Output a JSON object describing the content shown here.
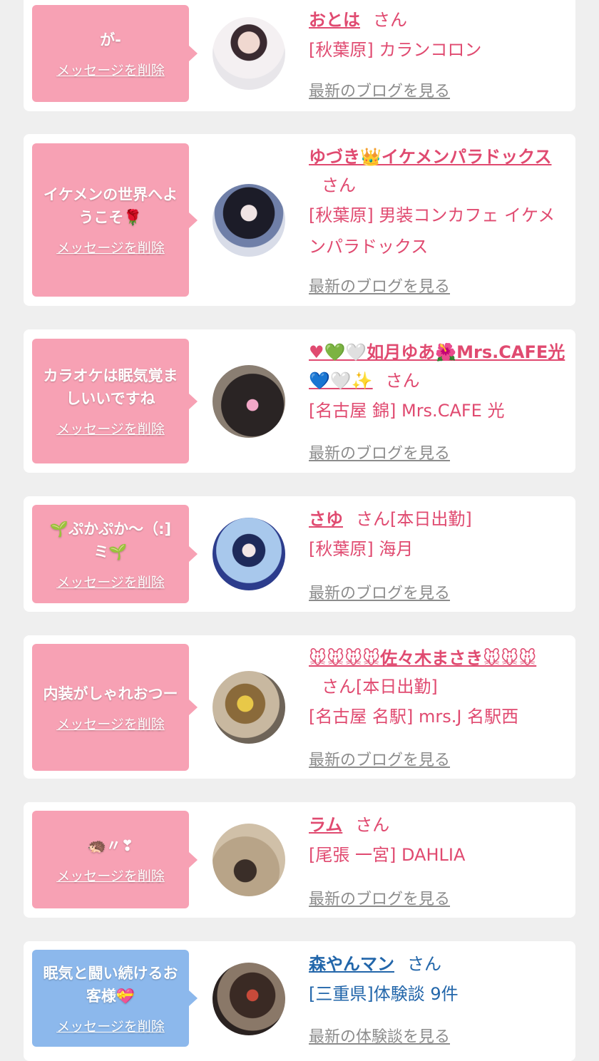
{
  "colors": {
    "bubble_pink": "#f7a1b4",
    "bubble_blue": "#8cb8ec",
    "name_pink": "#e04a70",
    "name_blue": "#2266aa",
    "blog_gray": "#8c8c8c"
  },
  "delete_label": "メッセージを削除",
  "san_label": "さん",
  "cards": [
    {
      "message": "が-",
      "name": "おとは",
      "working": "",
      "shop": "[秋葉原] カランコロン",
      "blog": "最新のブログを見る"
    },
    {
      "message": "イケメンの世界へようこそ🌹",
      "name": "ゆづき👑イケメンパラドックス",
      "working": "",
      "shop": "[秋葉原] 男装コンカフェ イケメンパラドックス",
      "blog": "最新のブログを見る"
    },
    {
      "message": "カラオケは眠気覚ましいいですね",
      "name": "♥💚🤍如月ゆあ🌺Mrs.CAFE光💙🤍✨",
      "working": "",
      "shop": "[名古屋 錦] Mrs.CAFE 光",
      "blog": "最新のブログを見る"
    },
    {
      "message": "🌱ぷかぷか～（:]ミ🌱",
      "name": "さゆ",
      "working": "[本日出勤]",
      "shop": "[秋葉原] 海月",
      "blog": "最新のブログを見る"
    },
    {
      "message": "内装がしゃれおつー",
      "name": "🐭🐭🐭🐭佐々木まさき🐭🐭🐭",
      "working": "[本日出勤]",
      "shop": "[名古屋 名駅] mrs.J 名駅西",
      "blog": "最新のブログを見る"
    },
    {
      "message": "🦔〃❣",
      "name": "ラム",
      "working": "",
      "shop": "[尾張 一宮] DAHLIA",
      "blog": "最新のブログを見る"
    },
    {
      "message": "眠気と闘い続けるお客様💝",
      "name": "森やんマン",
      "working": "",
      "shop": "[三重県]体験談 9件",
      "blog": "最新の体験談を見る"
    }
  ]
}
